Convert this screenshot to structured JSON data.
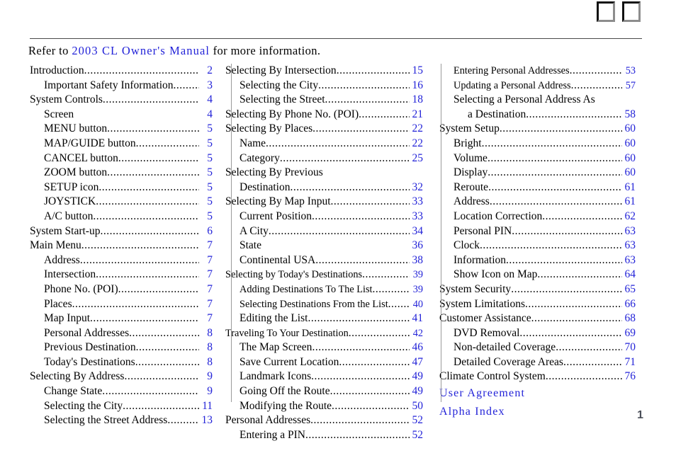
{
  "document": {
    "refer_prefix": "Refer to ",
    "refer_manual": "2003 CL Owner's Manual",
    "refer_suffix": " for more information.",
    "page_number": "1",
    "accent_color": "#2323d8"
  },
  "tabs": [
    {
      "name": "bookmark-tab-1"
    },
    {
      "name": "bookmark-tab-2"
    }
  ],
  "columns": [
    {
      "id": "column-1",
      "entries": [
        {
          "title": "Introduction",
          "page": "2",
          "level": 0,
          "leader": true
        },
        {
          "title": "Important Safety Information",
          "page": "3",
          "level": 1,
          "leader": true
        },
        {
          "title": "System Controls",
          "page": "4",
          "level": 0,
          "leader": true
        },
        {
          "title": "Screen",
          "page": "4",
          "level": 1,
          "leader": false
        },
        {
          "title": "MENU button",
          "page": "5",
          "level": 1,
          "leader": true
        },
        {
          "title": "MAP/GUIDE button",
          "page": "5",
          "level": 1,
          "leader": true
        },
        {
          "title": "CANCEL button",
          "page": "5",
          "level": 1,
          "leader": true
        },
        {
          "title": "ZOOM button",
          "page": "5",
          "level": 1,
          "leader": true
        },
        {
          "title": "SETUP icon",
          "page": "5",
          "level": 1,
          "leader": true
        },
        {
          "title": "JOYSTICK",
          "page": "5",
          "level": 1,
          "leader": true
        },
        {
          "title": "A/C button",
          "page": "5",
          "level": 1,
          "leader": true
        },
        {
          "title": "System Start-up",
          "page": "6",
          "level": 0,
          "leader": true
        },
        {
          "title": "Main Menu",
          "page": "7",
          "level": 0,
          "leader": true
        },
        {
          "title": "Address",
          "page": "7",
          "level": 1,
          "leader": true
        },
        {
          "title": "Intersection",
          "page": "7",
          "level": 1,
          "leader": true
        },
        {
          "title": "Phone No. (POI)",
          "page": "7",
          "level": 1,
          "leader": true
        },
        {
          "title": "Places",
          "page": "7",
          "level": 1,
          "leader": true
        },
        {
          "title": "Map Input",
          "page": "7",
          "level": 1,
          "leader": true
        },
        {
          "title": "Personal Addresses",
          "page": "8",
          "level": 1,
          "leader": true
        },
        {
          "title": "Previous Destination",
          "page": "8",
          "level": 1,
          "leader": true
        },
        {
          "title": "Today's Destinations",
          "page": "8",
          "level": 1,
          "leader": true
        },
        {
          "title": "Selecting By Address",
          "page": "9",
          "level": 0,
          "leader": true
        },
        {
          "title": "Change State",
          "page": "9",
          "level": 1,
          "leader": true
        },
        {
          "title": "Selecting the City",
          "page": "11",
          "level": 1,
          "leader": true
        },
        {
          "title": "Selecting the Street Address",
          "page": "13",
          "level": 1,
          "leader": true
        }
      ],
      "links": []
    },
    {
      "id": "column-2",
      "entries": [
        {
          "title": "Selecting By Intersection",
          "page": "15",
          "level": 0,
          "leader": true
        },
        {
          "title": "Selecting the City",
          "page": "16",
          "level": 1,
          "leader": true
        },
        {
          "title": "Selecting the Street",
          "page": "18",
          "level": 1,
          "leader": true
        },
        {
          "title": "Selecting By Phone No. (POI)",
          "page": "21",
          "level": 0,
          "leader": true
        },
        {
          "title": "Selecting By Places",
          "page": "22",
          "level": 0,
          "leader": true
        },
        {
          "title": "Name",
          "page": "22",
          "level": 1,
          "leader": true
        },
        {
          "title": "Category",
          "page": "25",
          "level": 1,
          "leader": true
        },
        {
          "title": "Selecting By Previous",
          "page": "",
          "level": 0,
          "leader": false,
          "wrap": true
        },
        {
          "title": "Destination",
          "page": "32",
          "level": 1,
          "leader": true
        },
        {
          "title": "Selecting By Map Input",
          "page": "33",
          "level": 0,
          "leader": true
        },
        {
          "title": "Current Position",
          "page": "33",
          "level": 1,
          "leader": true
        },
        {
          "title": "A City",
          "page": "34",
          "level": 1,
          "leader": true
        },
        {
          "title": "State",
          "page": "36",
          "level": 1,
          "leader": false
        },
        {
          "title": "Continental USA",
          "page": "38",
          "level": 1,
          "leader": true
        },
        {
          "title": "Selecting by Today's Destinations",
          "page": "39",
          "level": 0,
          "leader": true,
          "small": true
        },
        {
          "title": "Adding Destinations To The List",
          "page": "39",
          "level": 1,
          "leader": true,
          "small": true
        },
        {
          "title": "Selecting Destinations From the List",
          "page": "40",
          "level": 1,
          "leader": true,
          "small": true
        },
        {
          "title": "Editing the List",
          "page": "41",
          "level": 1,
          "leader": true
        },
        {
          "title": "Traveling To Your Destination",
          "page": "42",
          "level": 0,
          "leader": true,
          "small": true
        },
        {
          "title": "The Map Screen ",
          "page": "46",
          "level": 1,
          "leader": true
        },
        {
          "title": "Save Current Location",
          "page": "47",
          "level": 1,
          "leader": true
        },
        {
          "title": "Landmark Icons",
          "page": "49",
          "level": 1,
          "leader": true
        },
        {
          "title": "Going Off the Route",
          "page": "49",
          "level": 1,
          "leader": true
        },
        {
          "title": "Modifying the Route",
          "page": "50",
          "level": 1,
          "leader": true
        },
        {
          "title": "Personal Addresses",
          "page": "52",
          "level": 0,
          "leader": true
        },
        {
          "title": "Entering a PIN",
          "page": "52",
          "level": 1,
          "leader": true
        }
      ],
      "links": []
    },
    {
      "id": "column-3",
      "entries": [
        {
          "title": "Entering Personal Addresses",
          "page": "53",
          "level": 1,
          "leader": true,
          "small": true
        },
        {
          "title": "Updating a Personal Address",
          "page": "57",
          "level": 1,
          "leader": true,
          "small": true
        },
        {
          "title": "Selecting a Personal Address As",
          "page": "",
          "level": 1,
          "leader": false,
          "wrap": true
        },
        {
          "title": "a Destination",
          "page": "58",
          "level": 2,
          "leader": true
        },
        {
          "title": "System Setup",
          "page": "60",
          "level": 0,
          "leader": true
        },
        {
          "title": "Bright",
          "page": "60",
          "level": 1,
          "leader": true
        },
        {
          "title": "Volume",
          "page": "60",
          "level": 1,
          "leader": true
        },
        {
          "title": "Display",
          "page": "60",
          "level": 1,
          "leader": true
        },
        {
          "title": "Reroute",
          "page": "61",
          "level": 1,
          "leader": true
        },
        {
          "title": "Address",
          "page": "61",
          "level": 1,
          "leader": true
        },
        {
          "title": "Location Correction",
          "page": "62",
          "level": 1,
          "leader": true
        },
        {
          "title": "Personal PIN",
          "page": "63",
          "level": 1,
          "leader": true
        },
        {
          "title": "Clock",
          "page": "63",
          "level": 1,
          "leader": true
        },
        {
          "title": "Information",
          "page": "63",
          "level": 1,
          "leader": true
        },
        {
          "title": "Show Icon on Map",
          "page": "64",
          "level": 1,
          "leader": true
        },
        {
          "title": "System Security",
          "page": "65",
          "level": 0,
          "leader": true
        },
        {
          "title": "System Limitations",
          "page": "66",
          "level": 0,
          "leader": true
        },
        {
          "title": "Customer Assistance",
          "page": "68",
          "level": 0,
          "leader": true
        },
        {
          "title": "DVD Removal",
          "page": "69",
          "level": 1,
          "leader": true
        },
        {
          "title": "Non-detailed Coverage",
          "page": "70",
          "level": 1,
          "leader": true
        },
        {
          "title": "Detailed Coverage Areas",
          "page": "71",
          "level": 1,
          "leader": true
        },
        {
          "title": "Climate Control System",
          "page": "76",
          "level": 0,
          "leader": true
        }
      ],
      "links": [
        {
          "label": "User Agreement"
        },
        {
          "label": "Alpha Index"
        }
      ]
    }
  ]
}
